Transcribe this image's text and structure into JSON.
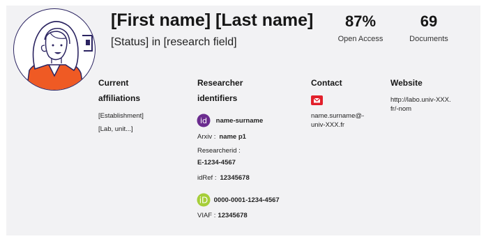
{
  "profile": {
    "name": "[First name] [Last name]",
    "status": "[Status] in [research field]"
  },
  "stats": {
    "open_access_value": "87%",
    "open_access_label": "Open Access",
    "documents_value": "69",
    "documents_label": "Documents"
  },
  "affiliations": {
    "title_line1": "Current",
    "title_line2": "affiliations",
    "items": [
      "[Establishment]",
      "[Lab, unit...]"
    ]
  },
  "identifiers": {
    "title_line1": "Researcher",
    "title_line2": "identifiers",
    "idhal": "name-surname",
    "arxiv_label": "Arxiv :",
    "arxiv_value": "name p1",
    "researcherid_label": "Researcherid :",
    "researcherid_value": "E-1234-4567",
    "idref_label": "idRef :",
    "idref_value": "12345678",
    "orcid": "0000-0001-1234-4567",
    "viaf_label": "VIAF :",
    "viaf_value": "12345678"
  },
  "contact": {
    "title": "Contact",
    "email_line1": "name.surname@-",
    "email_line2": "univ-XXX.fr",
    "icon": "mail-icon",
    "icon_color": "#e2202b"
  },
  "website": {
    "title": "Website",
    "url_line1": "http://labo.univ-XXX.",
    "url_line2": "fr/-nom"
  },
  "colors": {
    "background": "#f2f2f4",
    "idhal": "#6b2c8f",
    "orcid": "#a6ce39",
    "avatar_border": "#2b2461",
    "shirt": "#ef5a24"
  }
}
